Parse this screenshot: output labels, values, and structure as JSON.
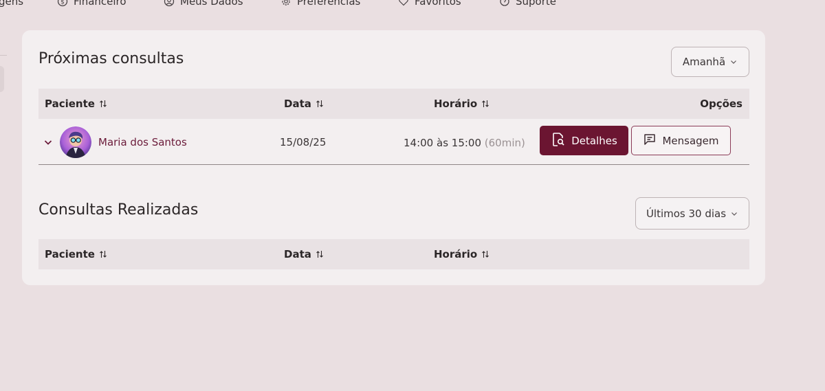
{
  "nav": {
    "items": [
      {
        "label": "gens",
        "icon": ""
      },
      {
        "label": "Financeiro",
        "icon": "dollar-circle-icon"
      },
      {
        "label": "Meus Dados",
        "icon": "user-circle-icon"
      },
      {
        "label": "Preferências",
        "icon": "gear-icon"
      },
      {
        "label": "Favoritos",
        "icon": "heart-icon"
      },
      {
        "label": "Suporte",
        "icon": "support-icon"
      }
    ]
  },
  "upcoming": {
    "title": "Próximas consultas",
    "filter": "Amanhã",
    "columns": {
      "patient": "Paciente",
      "date": "Data",
      "time": "Horário",
      "options": "Opções"
    },
    "rows": [
      {
        "patient": "Maria dos Santos",
        "date": "15/08/25",
        "time": "14:00 às 15:00",
        "duration": "(60min)",
        "details_label": "Detalhes",
        "message_label": "Mensagem"
      }
    ]
  },
  "completed": {
    "title": "Consultas Realizadas",
    "filter": "Últimos 30 dias",
    "columns": {
      "patient": "Paciente",
      "date": "Data",
      "time": "Horário"
    }
  },
  "colors": {
    "accent": "#6b1531",
    "patient_link": "#6b1b3a",
    "background": "#eadfe1",
    "card": "#f3eff0",
    "table_header": "#e9e2e4"
  }
}
